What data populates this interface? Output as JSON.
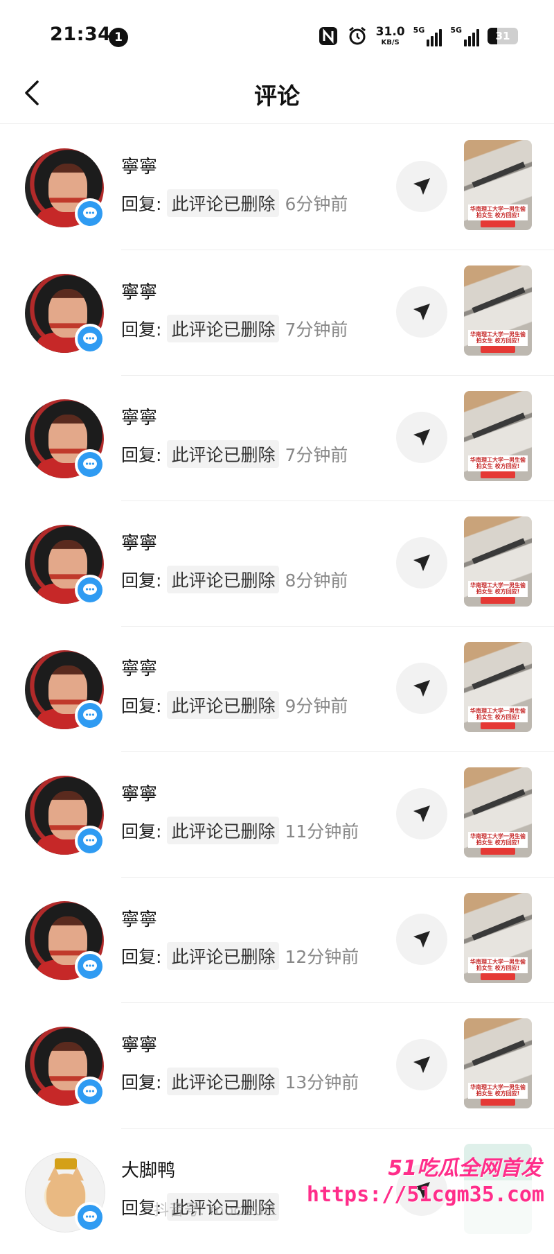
{
  "status_bar": {
    "time": "21:34",
    "notification_count": "1",
    "network_speed": "31.0",
    "network_speed_unit": "KB/S",
    "sim1_label": "5G",
    "sim2_label": "5G",
    "battery_level": "31"
  },
  "header": {
    "title": "评论",
    "back_icon": "chevron-left-icon"
  },
  "comments": [
    {
      "username": "寧寧",
      "reply_prefix": "回复:",
      "content": "此评论已删除",
      "time_ago": "6分钟前"
    },
    {
      "username": "寧寧",
      "reply_prefix": "回复:",
      "content": "此评论已删除",
      "time_ago": "7分钟前"
    },
    {
      "username": "寧寧",
      "reply_prefix": "回复:",
      "content": "此评论已删除",
      "time_ago": "7分钟前"
    },
    {
      "username": "寧寧",
      "reply_prefix": "回复:",
      "content": "此评论已删除",
      "time_ago": "8分钟前"
    },
    {
      "username": "寧寧",
      "reply_prefix": "回复:",
      "content": "此评论已删除",
      "time_ago": "9分钟前"
    },
    {
      "username": "寧寧",
      "reply_prefix": "回复:",
      "content": "此评论已删除",
      "time_ago": "11分钟前"
    },
    {
      "username": "寧寧",
      "reply_prefix": "回复:",
      "content": "此评论已删除",
      "time_ago": "12分钟前"
    },
    {
      "username": "寧寧",
      "reply_prefix": "回复:",
      "content": "此评论已删除",
      "time_ago": "13分钟前"
    },
    {
      "username": "大脚鸭",
      "reply_prefix": "回复:",
      "content": "此评论已删除",
      "time_ago": ""
    }
  ],
  "thumbnail_caption": "华南理工大学一男生偷拍女生 校方回应!",
  "overlay": {
    "watermark": "抖音号: mocizui1",
    "brand": "51吃瓜全网首发",
    "url": "https://51cgm35.com"
  },
  "colors": {
    "badge_blue": "#2f9bf2",
    "brand_pink": "#ff2d8a"
  }
}
